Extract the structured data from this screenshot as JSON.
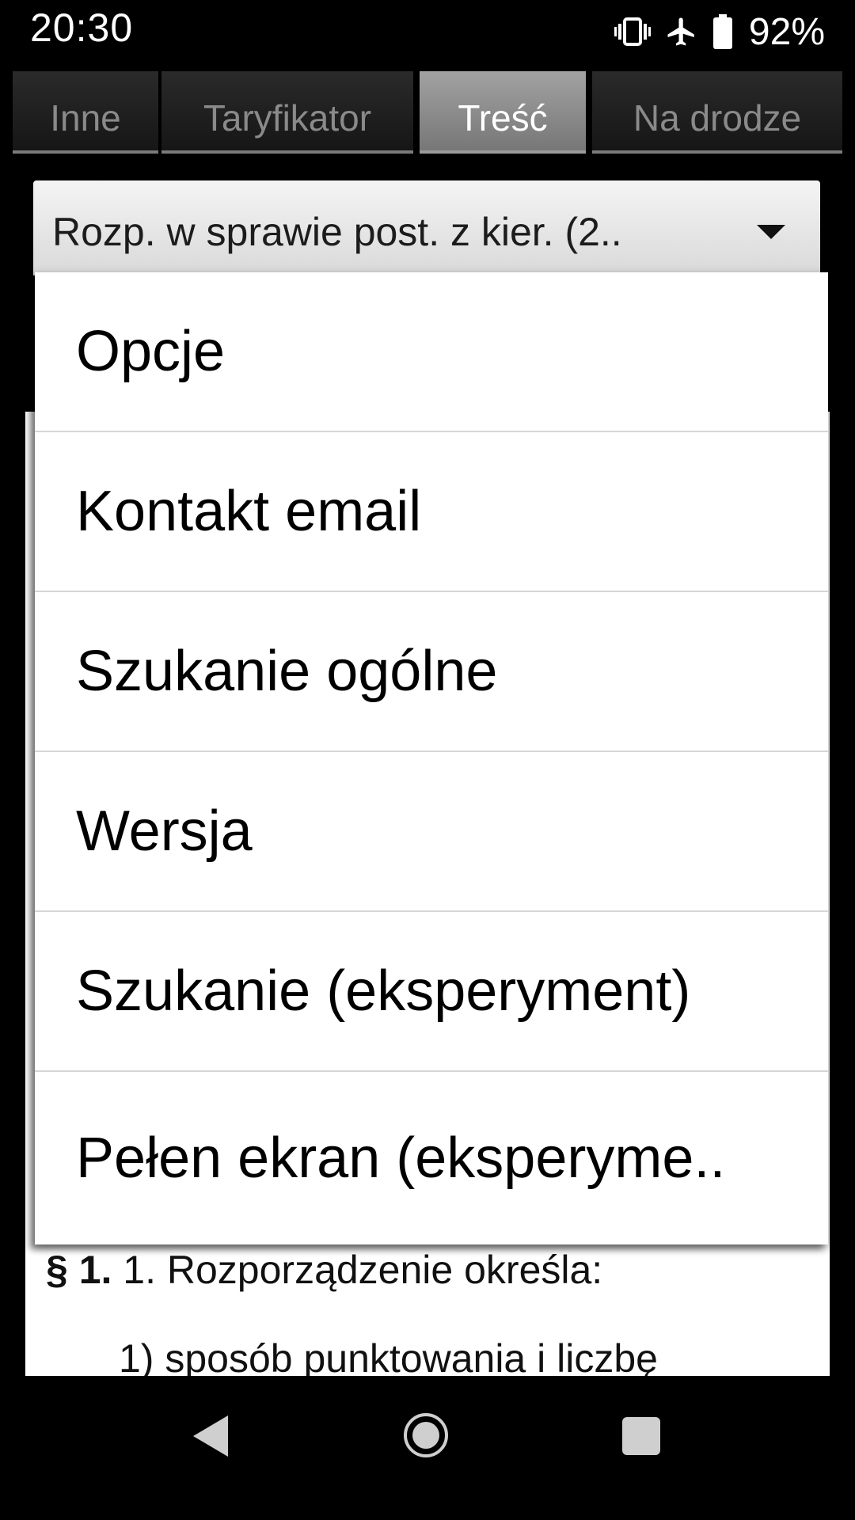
{
  "status_bar": {
    "time": "20:30",
    "battery_percent": "92%",
    "icons": [
      "vibrate-icon",
      "airplane-mode-icon",
      "battery-icon"
    ]
  },
  "tabs": [
    {
      "label": "Inne",
      "active": false
    },
    {
      "label": "Taryfikator",
      "active": false
    },
    {
      "label": "Treść",
      "active": true
    },
    {
      "label": "Na drodze",
      "active": false
    }
  ],
  "spinner": {
    "selected": "Rozp. w sprawie post. z kier. (2.."
  },
  "menu": {
    "items": [
      "Opcje",
      "Kontakt email",
      "Szukanie ogólne",
      "Wersja",
      "Szukanie (eksperyment)",
      "Pełen ekran (eksperyme.."
    ]
  },
  "content": {
    "line1_prefix": "§ 1.",
    "line1_text": " 1. Rozporządzenie określa:",
    "line2_text": "1) sposób punktowania i liczbę"
  },
  "nav_bar": {
    "icons": [
      "back-icon",
      "home-icon",
      "recents-icon"
    ]
  }
}
